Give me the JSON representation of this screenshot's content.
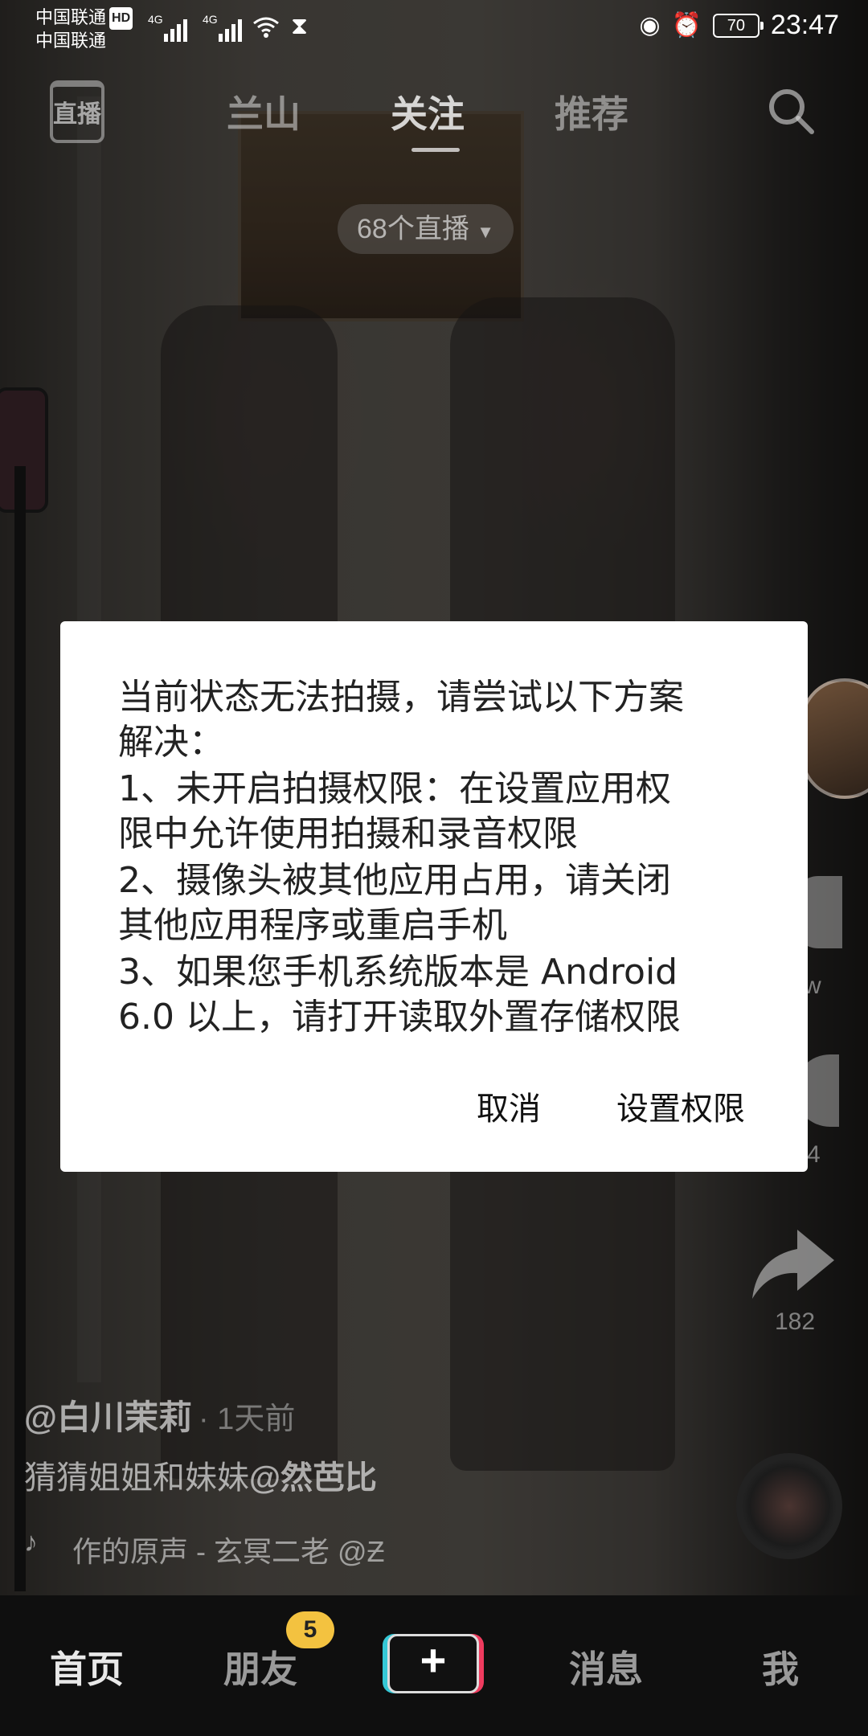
{
  "status_bar": {
    "carrier_1": "中国联通",
    "hd_badge": "HD",
    "carrier_2": "中国联通",
    "network_1": "4G",
    "network_2": "4G",
    "battery": "70",
    "time": "23:47"
  },
  "top_tabs": {
    "live": "直播",
    "tabs": [
      "兰山",
      "关注",
      "推荐"
    ],
    "active_tab": "关注"
  },
  "live_count": "68个直播",
  "right_rail": {
    "like_count_partial": "w",
    "comment_count_partial": "4",
    "share_count": "182"
  },
  "video_info": {
    "author": "@白川茉莉",
    "time": "· 1天前",
    "description_prefix": "猜猜姐姐和妹妹",
    "description_mention": "@然芭比",
    "music": "作的原声 - 玄冥二老   @Ƶ"
  },
  "bottom_nav": {
    "home": "首页",
    "friends": "朋友",
    "friends_badge": "5",
    "add": "+",
    "messages": "消息",
    "me": "我"
  },
  "dialog": {
    "lines": [
      "当前状态无法拍摄，请尝试以下方案",
      "解决：",
      " 1、未开启拍摄权限：在设置应用权",
      "限中允许使用拍摄和录音权限",
      " 2、摄像头被其他应用占用，请关闭",
      "其他应用程序或重启手机",
      " 3、如果您手机系统版本是 Android",
      "6.0 以上，请打开读取外置存储权限"
    ],
    "cancel_label": "取消",
    "settings_label": "设置权限"
  }
}
